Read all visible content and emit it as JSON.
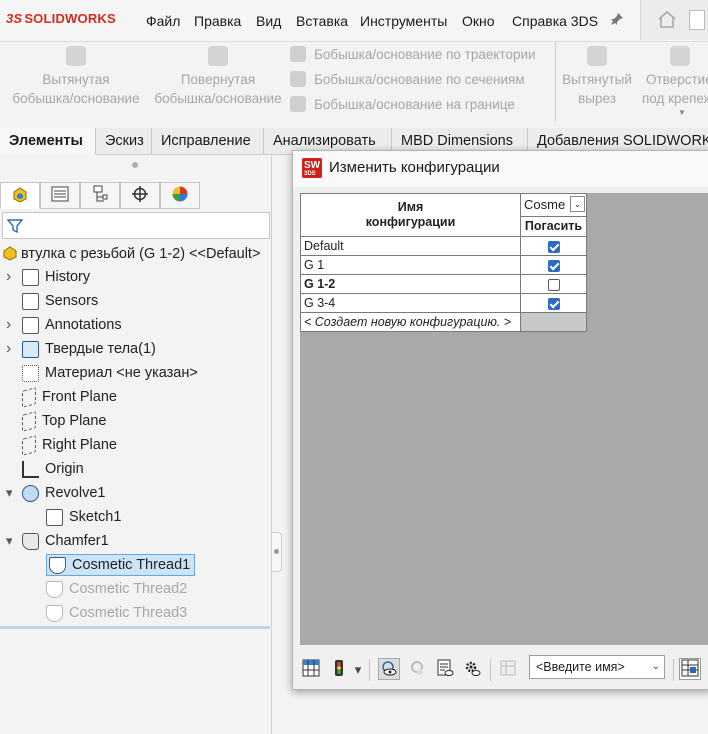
{
  "app": {
    "logo_prefix": "3S",
    "logo_text": "SOLIDWORKS"
  },
  "menu": [
    "Файл",
    "Правка",
    "Вид",
    "Вставка",
    "Инструменты",
    "Окно",
    "Справка 3DS"
  ],
  "ribbon": {
    "extrude_boss": [
      "Вытянутая",
      "бобышка/основание"
    ],
    "revolve_boss": [
      "Повернутая",
      "бобышка/основание"
    ],
    "sweep_boss": "Бобышка/основание по траектории",
    "loft_boss": "Бобышка/основание по сечениям",
    "boundary_boss": "Бобышка/основание на границе",
    "extrude_cut": [
      "Вытянутый",
      "вырез"
    ],
    "hole_wizard": [
      "Отверстие",
      "под крепеж"
    ]
  },
  "tabs": [
    "Элементы",
    "Эскиз",
    "Исправление",
    "Анализировать",
    "MBD Dimensions",
    "Добавления SOLIDWORKS"
  ],
  "feature_tree": {
    "root": "втулка с резьбой (G 1-2) <<Default>",
    "items": [
      {
        "label": "History",
        "expandable": true,
        "icon": "history-icon"
      },
      {
        "label": "Sensors",
        "expandable": false,
        "icon": "sensors-icon"
      },
      {
        "label": "Annotations",
        "expandable": true,
        "icon": "annotations-icon"
      },
      {
        "label": "Твердые тела(1)",
        "expandable": true,
        "icon": "solid-bodies-icon"
      },
      {
        "label": "Материал <не указан>",
        "expandable": false,
        "icon": "material-icon"
      },
      {
        "label": "Front Plane",
        "expandable": false,
        "icon": "plane-icon"
      },
      {
        "label": "Top Plane",
        "expandable": false,
        "icon": "plane-icon"
      },
      {
        "label": "Right Plane",
        "expandable": false,
        "icon": "plane-icon"
      },
      {
        "label": "Origin",
        "expandable": false,
        "icon": "origin-icon"
      },
      {
        "label": "Revolve1",
        "expandable": true,
        "expanded": true,
        "icon": "revolve-icon"
      },
      {
        "label": "Sketch1",
        "child": true,
        "icon": "sketch-icon"
      },
      {
        "label": "Chamfer1",
        "expandable": true,
        "expanded": true,
        "icon": "chamfer-icon"
      },
      {
        "label": "Cosmetic Thread1",
        "child": true,
        "selected": true,
        "icon": "cosmetic-thread-icon"
      },
      {
        "label": "Cosmetic Thread2",
        "child": true,
        "suppressed": true,
        "icon": "cosmetic-thread-icon"
      },
      {
        "label": "Cosmetic Thread3",
        "child": true,
        "suppressed": true,
        "icon": "cosmetic-thread-icon"
      }
    ]
  },
  "dialog": {
    "title": "Изменить конфигурации",
    "name_header": [
      "Имя",
      "конфигурации"
    ],
    "feature_header": "Cosme",
    "suppress_header": "Погасить",
    "rows": [
      {
        "name": "Default",
        "suppressed": true,
        "bold": false
      },
      {
        "name": "G 1",
        "suppressed": true,
        "bold": false
      },
      {
        "name": "G 1-2",
        "suppressed": false,
        "bold": true
      },
      {
        "name": "G 3-4",
        "suppressed": true,
        "bold": false
      }
    ],
    "new_row": "< Создает новую конфигурацию. >",
    "name_select": "<Введите имя>"
  },
  "colors": {
    "brand_red": "#d52b1e",
    "checkbox_blue": "#2d6bc4",
    "selection": "#cde4f7"
  }
}
